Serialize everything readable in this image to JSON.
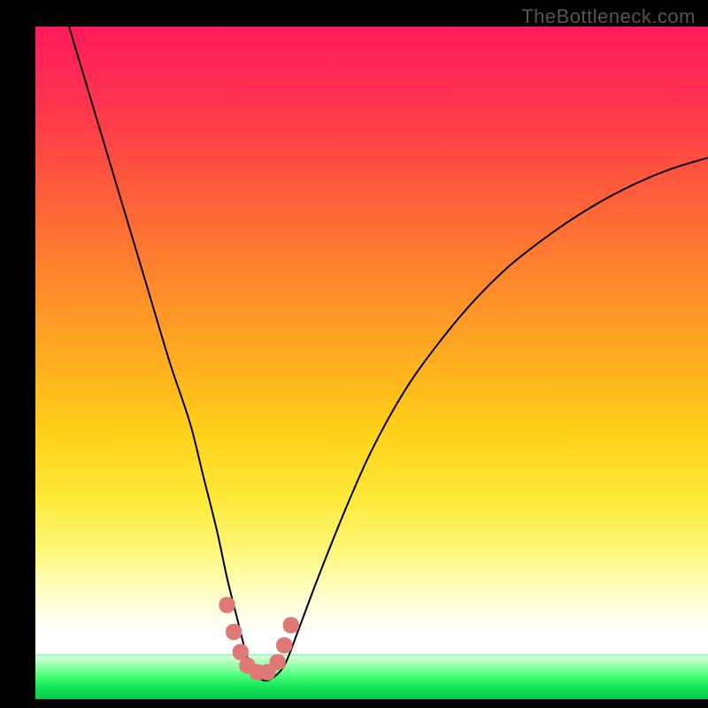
{
  "watermark": "TheBottleneck.com",
  "chart_data": {
    "type": "line",
    "title": "",
    "xlabel": "",
    "ylabel": "",
    "xlim": [
      0,
      100
    ],
    "ylim": [
      0,
      100
    ],
    "legend": null,
    "annotations": [],
    "background_gradient": {
      "orientation": "vertical",
      "stops": [
        {
          "pos": 0.0,
          "color": "#ff1a5a"
        },
        {
          "pos": 0.3,
          "color": "#ff6a35"
        },
        {
          "pos": 0.55,
          "color": "#ffc81e"
        },
        {
          "pos": 0.8,
          "color": "#fff77a"
        },
        {
          "pos": 0.93,
          "color": "#ffffff"
        },
        {
          "pos": 0.95,
          "color": "#9fffaf"
        },
        {
          "pos": 1.0,
          "color": "#08c84a"
        }
      ]
    },
    "series": [
      {
        "name": "bottleneck-curve",
        "color": "#000000",
        "stroke_width": 2,
        "x": [
          5,
          8,
          11,
          14,
          17,
          20,
          23,
          25,
          27,
          28.5,
          30,
          31,
          32,
          33.5,
          35,
          37,
          39,
          42,
          46,
          50,
          55,
          60,
          65,
          70,
          75,
          80,
          85,
          90,
          95,
          100
        ],
        "y": [
          100,
          90,
          80,
          70,
          60,
          50,
          41,
          33,
          25,
          18,
          12,
          8,
          5,
          3,
          3,
          5,
          10,
          18,
          28,
          37,
          46,
          53,
          59,
          64,
          68,
          71.5,
          74.5,
          77,
          79,
          80.5
        ]
      },
      {
        "name": "minimum-marker",
        "type": "scatter",
        "color": "#e07878",
        "marker_size": 14,
        "x": [
          28.5,
          29.5,
          30.5,
          31.5,
          33,
          34.5,
          36,
          37,
          38
        ],
        "y": [
          14,
          10,
          7,
          5,
          4,
          4,
          5.5,
          8,
          11
        ]
      }
    ]
  }
}
